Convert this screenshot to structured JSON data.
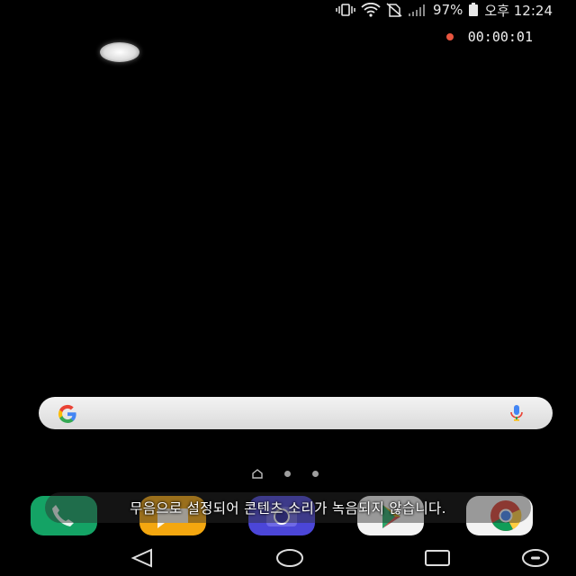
{
  "status_bar": {
    "battery_percent": "97%",
    "time": "오후 12:24",
    "icons": [
      "vibrate-icon",
      "wifi-icon",
      "no-sim-icon",
      "signal-icon",
      "battery-icon"
    ]
  },
  "recording": {
    "elapsed": "00:00:01",
    "indicator_color": "#e8553f"
  },
  "search_bar": {
    "logo": "google-g-icon",
    "voice_icon": "microphone-icon"
  },
  "pager": {
    "pages": [
      "home",
      "page-2",
      "page-3"
    ],
    "current": "home"
  },
  "dock": {
    "apps": [
      {
        "name": "phone",
        "color": "#14a365"
      },
      {
        "name": "messages",
        "color": "#f4a70f"
      },
      {
        "name": "camera",
        "color": "#4b46d8"
      },
      {
        "name": "play-store",
        "color": "#f3f3f3"
      },
      {
        "name": "chrome",
        "color": "#f3f3f3"
      }
    ]
  },
  "toast": {
    "message": "무음으로 설정되어 콘텐츠 소리가 녹음되지 않습니다."
  },
  "nav_bar": {
    "buttons": [
      "back-icon",
      "home-icon",
      "recents-icon",
      "notification-dot-icon"
    ]
  }
}
